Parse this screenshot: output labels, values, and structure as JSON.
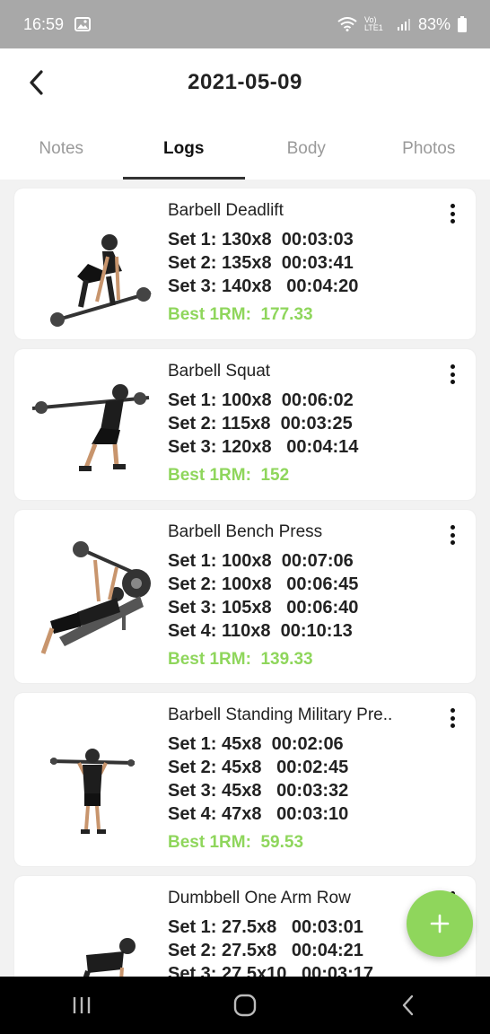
{
  "status_bar": {
    "time": "16:59",
    "battery": "83%",
    "network_label": "Vo) LTE1"
  },
  "header": {
    "title": "2021-05-09",
    "back_icon": "chevron-left-icon"
  },
  "tabs": [
    {
      "label": "Notes",
      "active": false
    },
    {
      "label": "Logs",
      "active": true
    },
    {
      "label": "Body",
      "active": false
    },
    {
      "label": "Photos",
      "active": false
    }
  ],
  "exercises": [
    {
      "name": "Barbell Deadlift",
      "sets": [
        "Set 1: 130x8  00:03:03",
        "Set 2: 135x8  00:03:41",
        "Set 3: 140x8   00:04:20"
      ],
      "best": "Best 1RM:  177.33"
    },
    {
      "name": "Barbell Squat",
      "sets": [
        "Set 1: 100x8  00:06:02",
        "Set 2: 115x8  00:03:25",
        "Set 3: 120x8   00:04:14"
      ],
      "best": "Best 1RM:  152"
    },
    {
      "name": "Barbell Bench Press",
      "sets": [
        "Set 1: 100x8  00:07:06",
        "Set 2: 100x8   00:06:45",
        "Set 3: 105x8   00:06:40",
        "Set 4: 110x8  00:10:13"
      ],
      "best": "Best 1RM:  139.33"
    },
    {
      "name": "Barbell Standing Military Pre..",
      "sets": [
        "Set 1: 45x8  00:02:06",
        "Set 2: 45x8   00:02:45",
        "Set 3: 45x8   00:03:32",
        "Set 4: 47x8   00:03:10"
      ],
      "best": "Best 1RM:  59.53"
    },
    {
      "name": "Dumbbell One Arm Row",
      "sets": [
        "Set 1: 27.5x8   00:03:01",
        "Set 2: 27.5x8   00:04:21",
        "Set 3: 27.5x10   00:03:17"
      ],
      "best": ""
    }
  ],
  "fab": {
    "icon": "plus-icon"
  },
  "nav": {
    "recents_icon": "recents-icon",
    "home_icon": "home-icon",
    "back_icon": "back-icon"
  },
  "colors": {
    "accent": "#8fd65c",
    "status_bar": "#a8a8a8"
  }
}
